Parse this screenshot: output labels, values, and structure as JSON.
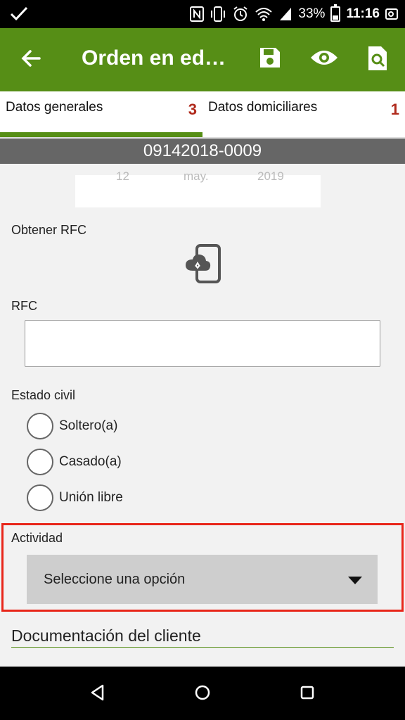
{
  "status_bar": {
    "battery_percent": "33%",
    "time": "11:16",
    "battery_level": 0.33,
    "icons": [
      "check-icon",
      "nfc-icon",
      "vibrate-icon",
      "alarm-icon",
      "wifi-icon",
      "signal-icon",
      "battery-icon",
      "pm-icon"
    ]
  },
  "app_bar": {
    "title": "Orden en edi…",
    "actions": [
      "save-icon",
      "view-icon",
      "search-document-icon"
    ],
    "color": "#568e16"
  },
  "tabs": [
    {
      "label": "Datos generales",
      "count": "3"
    },
    {
      "label": "Datos domiciliares",
      "count": "1"
    }
  ],
  "order_number": "09142018-0009",
  "date_picker": {
    "day": "12",
    "month": "may.",
    "year": "2019"
  },
  "form": {
    "obtener_rfc_label": "Obtener RFC",
    "rfc_label": "RFC",
    "rfc_value": "",
    "estado_civil_label": "Estado civil",
    "estado_civil_options": [
      "Soltero(a)",
      "Casado(a)",
      "Unión libre"
    ],
    "actividad_label": "Actividad",
    "actividad_value": "Seleccione una opción",
    "documentacion_title": "Documentación del cliente"
  },
  "colors": {
    "accent": "#568e16",
    "badge": "#b02a1c",
    "highlight": "#e8261a"
  }
}
